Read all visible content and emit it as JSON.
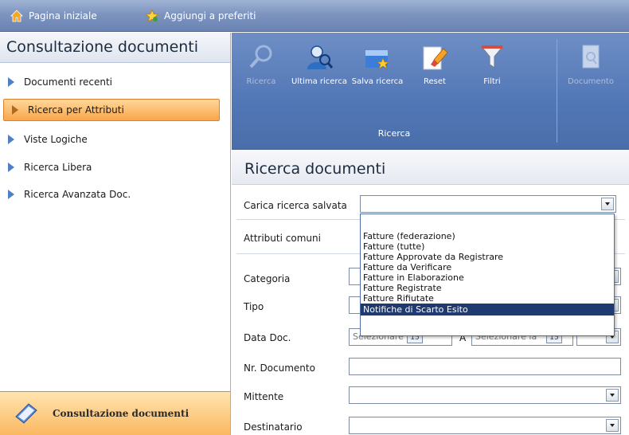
{
  "topbar": {
    "home_label": "Pagina iniziale",
    "favorites_label": "Aggiungi a preferiti"
  },
  "sidebar": {
    "title": "Consultazione documenti",
    "items": [
      {
        "label": "Documenti recenti"
      },
      {
        "label": "Ricerca per Attributi"
      },
      {
        "label": "Viste Logiche"
      },
      {
        "label": "Ricerca Libera"
      },
      {
        "label": "Ricerca Avanzata Doc."
      }
    ],
    "active_index": 1,
    "footer_label": "Consultazione documenti"
  },
  "ribbon": {
    "buttons": [
      {
        "label": "Ricerca",
        "enabled": false,
        "icon": "search-icon"
      },
      {
        "label": "Ultima ricerca",
        "enabled": true,
        "icon": "user-search-icon"
      },
      {
        "label": "Salva ricerca",
        "enabled": true,
        "icon": "save-search-icon"
      },
      {
        "label": "Reset",
        "enabled": true,
        "icon": "eraser-icon"
      },
      {
        "label": "Filtri",
        "enabled": true,
        "icon": "filter-icon"
      },
      {
        "label": "Documento",
        "enabled": false,
        "icon": "document-preview-icon"
      }
    ],
    "group_label": "Ricerca"
  },
  "main": {
    "title": "Ricerca documenti",
    "fields": {
      "carica": {
        "label": "Carica ricerca salvata",
        "value": ""
      },
      "attributi": {
        "label": "Attributi comuni"
      },
      "categoria": {
        "label": "Categoria",
        "value": ""
      },
      "tipo": {
        "label": "Tipo",
        "value": ""
      },
      "data": {
        "label": "Data Doc.",
        "from_placeholder": "Selezionare la",
        "to_label": "A",
        "to_placeholder": "Selezionare la",
        "calendar_text": "15"
      },
      "nr_documento": {
        "label": "Nr. Documento",
        "value": ""
      },
      "mittente": {
        "label": "Mittente",
        "value": ""
      },
      "destinatario": {
        "label": "Destinatario",
        "value": ""
      }
    }
  },
  "dropdown": {
    "options": [
      "Fatture (federazione)",
      "Fatture (tutte)",
      "Fatture Approvate da Registrare",
      "Fatture da Verificare",
      "Fatture in Elaborazione",
      "Fatture Registrate",
      "Fatture Rifiutate",
      "Notifiche di Scarto Esito"
    ],
    "selected_index": 7
  },
  "colors": {
    "ribbon": "#5277b6",
    "active_item": "#f9a64a",
    "selected_option": "#1f3a70"
  }
}
